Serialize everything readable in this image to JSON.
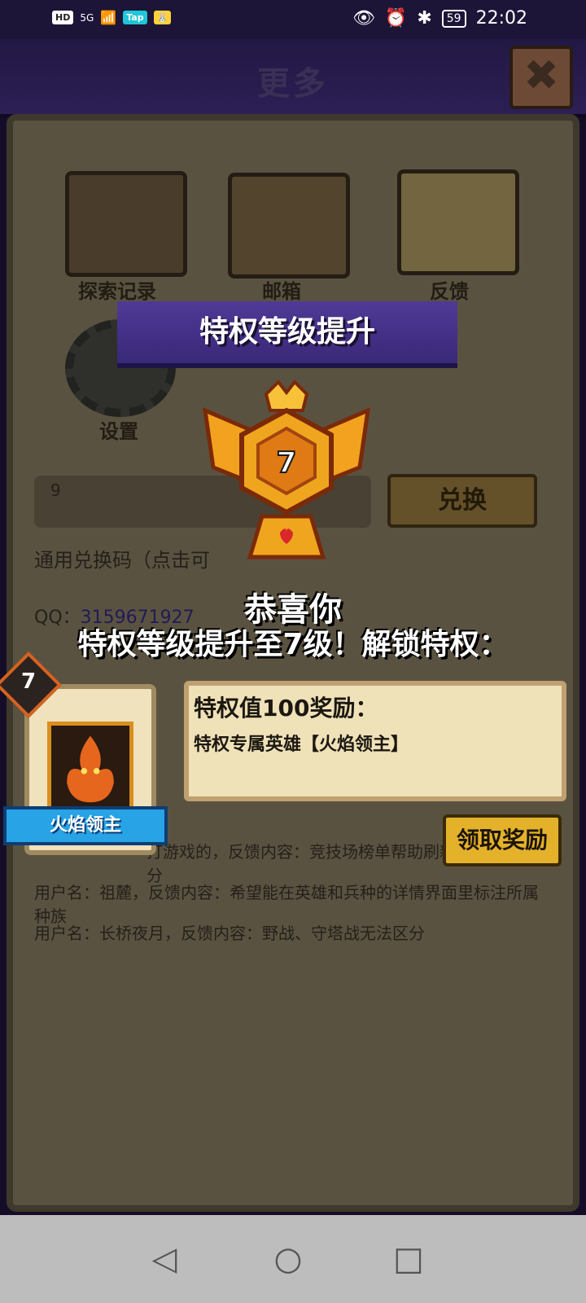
{
  "status_bar": {
    "left_chips": [
      "HD",
      "5G",
      "Tap"
    ],
    "battery": "59",
    "time": "22:02",
    "icons": [
      "eye-icon",
      "alarm-icon",
      "bluetooth-icon"
    ]
  },
  "header": {
    "title": "更多",
    "close_glyph": "✖"
  },
  "menu": {
    "explore_record": "探索记录",
    "mailbox": "邮箱",
    "feedback": "反馈",
    "settings": "设置"
  },
  "redeem": {
    "code_value": "9",
    "button": "兑换",
    "hint": "通用兑换码（点击可"
  },
  "background_text": {
    "qq_label": "QQ：",
    "qq_number": "3159671927",
    "line1": "用户名：祖麓，反馈内容：希望能在英雄和兵种的详情界面里标注所属种族",
    "line2": "用户名：长桥夜月，反馈内容：野战、守塔战无法区分",
    "line3": "打游戏的，反馈内容：竞技场榜单帮助刷新区分"
  },
  "modal": {
    "banner": "特权等级提升",
    "emblem_level": "7",
    "congrats": "恭喜你",
    "unlock": "特权等级提升至7级！解锁特权：",
    "hero_level": "7",
    "hero_name": "火焰领主",
    "reward_title": "特权值100奖励：",
    "reward_desc": "特权专属英雄【火焰领主】",
    "claim_button": "领取奖励"
  },
  "nav": {
    "back": "◁",
    "home": "○",
    "recent": "□"
  }
}
